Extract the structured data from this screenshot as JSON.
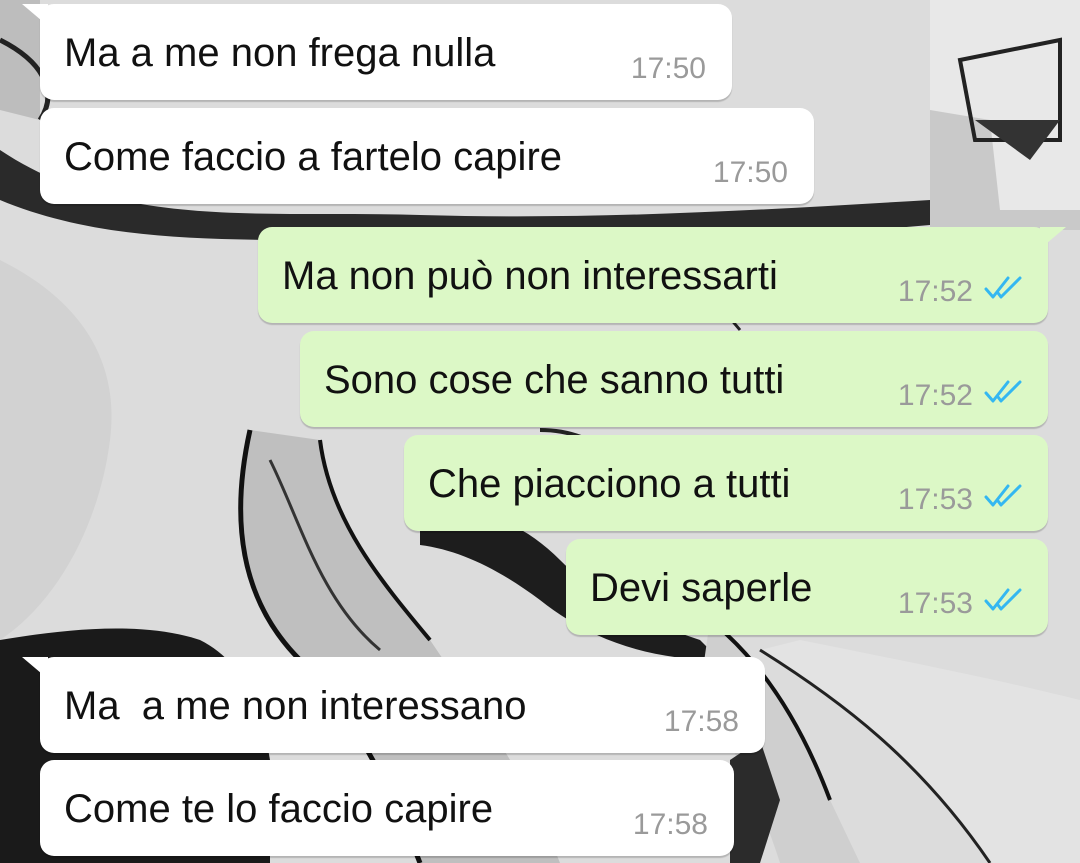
{
  "messages": [
    {
      "text": "Ma a me non frega nulla",
      "time": "17:50",
      "direction": "incoming"
    },
    {
      "text": "Come faccio a fartelo capire",
      "time": "17:50",
      "direction": "incoming"
    },
    {
      "text": "Ma non può non interessarti",
      "time": "17:52",
      "direction": "outgoing",
      "status": "read"
    },
    {
      "text": "Sono cose che sanno tutti",
      "time": "17:52",
      "direction": "outgoing",
      "status": "read"
    },
    {
      "text": "Che piacciono a tutti",
      "time": "17:53",
      "direction": "outgoing",
      "status": "read"
    },
    {
      "text": "Devi saperle",
      "time": "17:53",
      "direction": "outgoing",
      "status": "read"
    },
    {
      "text": "Ma  a me non interessano",
      "time": "17:58",
      "direction": "incoming"
    },
    {
      "text": "Come te lo faccio capire",
      "time": "17:58",
      "direction": "incoming"
    }
  ],
  "colors": {
    "incoming_bubble": "#ffffff",
    "outgoing_bubble": "#dcf8c6",
    "read_ticks": "#34b7f1",
    "timestamp": "#9a9a9a"
  },
  "icons": {
    "read_status": "double-check-icon"
  }
}
